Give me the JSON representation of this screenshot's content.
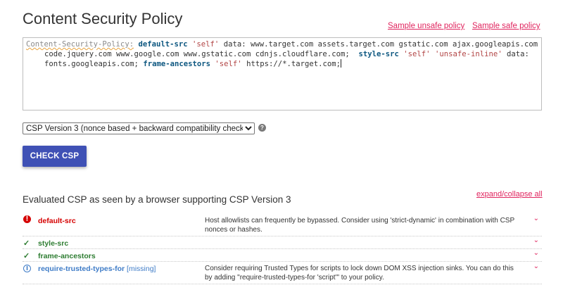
{
  "title": "Content Security Policy",
  "links": {
    "unsafe": "Sample unsafe policy",
    "safe": "Sample safe policy",
    "expand": "expand/collapse all"
  },
  "policy": {
    "header": "Content-Security-Policy:",
    "t1": "default-src",
    "t2": "'self'",
    "t3": "data:",
    "t4": "www.target.com assets.target.com gstatic.com ajax.googleapis.com",
    "t5": "code.jquery.com www.google.com www.gstatic.com cdnjs.cloudflare.com;",
    "t6": "style-src",
    "t7": "'self'",
    "t8": "'unsafe-inline'",
    "t9": "data:",
    "t10": "fonts.googleapis.com;",
    "t11": "frame-ancestors",
    "t12": "'self'",
    "t13": "https://*.target.com;"
  },
  "version_select": {
    "selected": "CSP Version 3 (nonce based + backward compatibility checks)",
    "help": "?"
  },
  "check_button": "CHECK CSP",
  "evaluated_title": "Evaluated CSP as seen by a browser supporting CSP Version 3",
  "findings": [
    {
      "icon": "!",
      "directive": "default-src",
      "description": "Host allowlists can frequently be bypassed. Consider using 'strict-dynamic' in combination with CSP nonces or hashes.",
      "status": "error"
    },
    {
      "icon": "✓",
      "directive": "style-src",
      "description": "",
      "status": "ok"
    },
    {
      "icon": "✓",
      "directive": "frame-ancestors",
      "description": "",
      "status": "ok"
    },
    {
      "icon": "i",
      "directive": "require-trusted-types-for",
      "missing": "[missing]",
      "description": "Consider requiring Trusted Types for scripts to lock down DOM XSS injection sinks. You can do this by adding \"require-trusted-types-for 'script'\" to your policy.",
      "status": "info"
    }
  ],
  "chevron": "⌄",
  "colors": {
    "accent": "#3f51b5",
    "link": "#e0245e",
    "error": "#d50000",
    "ok": "#2e7d32",
    "info": "#3f7cc7"
  }
}
